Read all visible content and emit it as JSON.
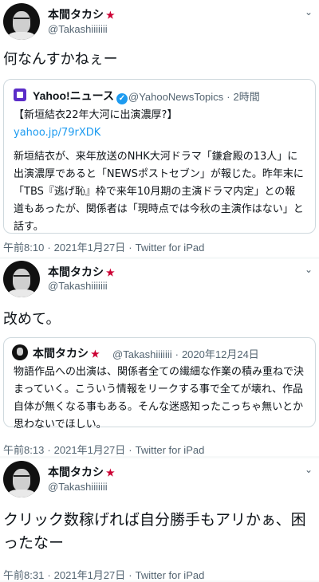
{
  "tweets": [
    {
      "name": "本間タカシ",
      "handle": "@Takashiiiiiii",
      "text": "何なんすかねぇー",
      "quote": {
        "source_name": "Yahoo!ニュース",
        "source_handle": "@YahooNewsTopics",
        "time": "2時間",
        "headline": "【新垣結衣22年大河に出演濃厚?】",
        "link": "yahoo.jp/79rXDK",
        "body": "新垣結衣が、来年放送のNHK大河ドラマ「鎌倉殿の13人」に出演濃厚であると「NEWSポストセブン」が報じた。昨年末に「TBS『逃げ恥』枠で来年10月期の主演ドラマ内定」との報道もあったが、関係者は「現時点では今秋の主演作はない」と話す。"
      },
      "meta": {
        "time": "午前8:10",
        "date": "2021年1月27日",
        "client": "Twitter for iPad"
      }
    },
    {
      "name": "本間タカシ",
      "handle": "@Takashiiiiiii",
      "text": "改めて。",
      "quote": {
        "source_name": "本間タカシ",
        "source_handle": "@Takashiiiiiii",
        "time": "2020年12月24日",
        "body": "物語作品への出演は、関係者全ての繊細な作業の積み重ねで決まっていく。こういう情報をリークする事で全てが壊れ、作品自体が無くなる事もある。そんな迷惑知ったこっちゃ無いとか思わないでほしい。"
      },
      "meta": {
        "time": "午前8:13",
        "date": "2021年1月27日",
        "client": "Twitter for iPad"
      }
    },
    {
      "name": "本間タカシ",
      "handle": "@Takashiiiiiii",
      "text": "クリック数稼げれば自分勝手もアリかぁ、困ったなー",
      "meta": {
        "time": "午前8:31",
        "date": "2021年1月27日",
        "client": "Twitter for iPad"
      }
    }
  ],
  "icons": {
    "badge": "★",
    "verified": "✓",
    "more": "⌄",
    "separator": "·"
  },
  "colors": {
    "link": "#1d9bf0",
    "muted": "#536471"
  }
}
